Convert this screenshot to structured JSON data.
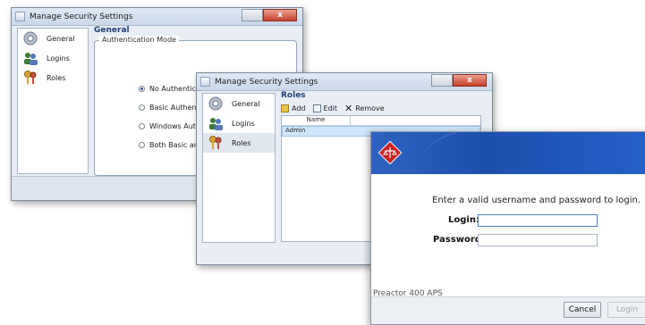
{
  "window1": {
    "title": "Manage Security Settings",
    "close_glyph": "x",
    "nav": [
      {
        "label": "General",
        "icon": "gear-icon"
      },
      {
        "label": "Logins",
        "icon": "users-icon"
      },
      {
        "label": "Roles",
        "icon": "keys-icon"
      }
    ],
    "heading": "General",
    "group_title": "Authentication Mode",
    "options": [
      {
        "label": "No Authentication",
        "selected": true
      },
      {
        "label": "Basic Authentication",
        "selected": false
      },
      {
        "label": "Windows Authentic",
        "selected": false
      },
      {
        "label": "Both Basic and Wind",
        "selected": false
      }
    ]
  },
  "window2": {
    "title": "Manage Security Settings",
    "close_glyph": "x",
    "nav": [
      {
        "label": "General",
        "icon": "gear-icon"
      },
      {
        "label": "Logins",
        "icon": "users-icon"
      },
      {
        "label": "Roles",
        "icon": "keys-icon",
        "selected": true
      }
    ],
    "heading": "Roles",
    "toolbar": {
      "add": "Add",
      "edit": "Edit",
      "remove": "Remove"
    },
    "table": {
      "column": "Name",
      "rows": [
        "Admin"
      ]
    }
  },
  "login": {
    "prompt": "Enter a valid username and password to login.",
    "login_label": "Login:",
    "password_label": "Password:",
    "login_value": "",
    "password_value": "",
    "footer": "Preactor 400 APS",
    "cancel": "Cancel",
    "login_button": "Login",
    "brand_color": "#cc2222"
  },
  "colors": {
    "accent": "#1f3f78",
    "header_blue": "#2459bf"
  }
}
